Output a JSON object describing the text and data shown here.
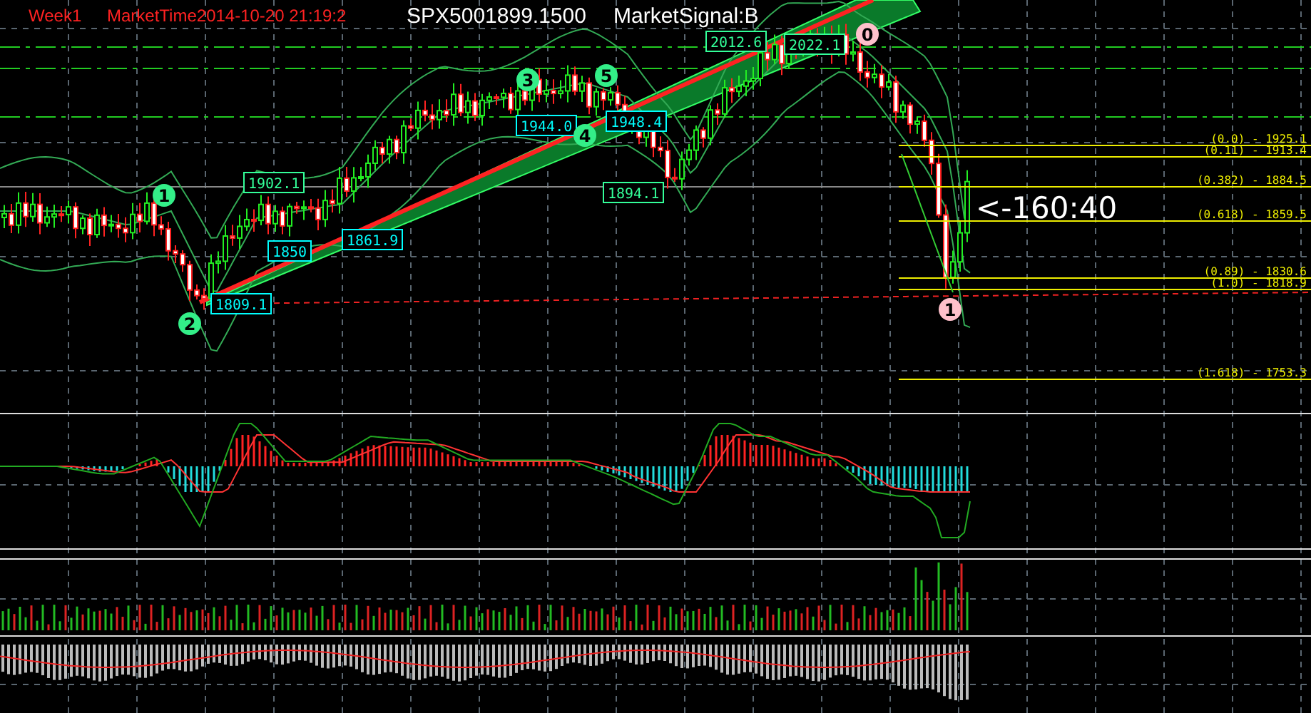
{
  "header": {
    "timeframe": "Week1",
    "market_time": "MarketTime2014-10-20 21:19:2",
    "symbol_price": "SPX5001899.1500",
    "signal": "MarketSignal:B"
  },
  "price_labels": [
    {
      "text": "1809.1",
      "color": "#00ffff"
    },
    {
      "text": "1902.1",
      "color": "#33ff99"
    },
    {
      "text": "1850",
      "color": "#00ffff"
    },
    {
      "text": "1861.9",
      "color": "#00ffff"
    },
    {
      "text": "1944.0",
      "color": "#00ffff"
    },
    {
      "text": "1948.4",
      "color": "#00ffff"
    },
    {
      "text": "1894.1",
      "color": "#33ff99"
    },
    {
      "text": "2012.6",
      "color": "#33ff99"
    },
    {
      "text": "2022.1",
      "color": "#33ff99"
    }
  ],
  "wave_markers": [
    {
      "label": "1",
      "color": "#33ee88"
    },
    {
      "label": "2",
      "color": "#33ee88"
    },
    {
      "label": "3",
      "color": "#33ee88"
    },
    {
      "label": "4",
      "color": "#33ee88"
    },
    {
      "label": "5",
      "color": "#33ee88"
    },
    {
      "label": "0",
      "color": "#ffc0cb"
    },
    {
      "label": "1",
      "color": "#ffc0cb"
    }
  ],
  "fib_levels": [
    {
      "label": "(0.0) - 1925.1"
    },
    {
      "label": "(0.11) - 1913.4"
    },
    {
      "label": "(0.382) - 1884.5"
    },
    {
      "label": "(0.618) - 1859.5"
    },
    {
      "label": "(0.89) - 1830.6"
    },
    {
      "label": "(1.0) - 1818.9"
    },
    {
      "label": "(1.618) - 1753.3"
    }
  ],
  "countdown": "<-160:40"
}
